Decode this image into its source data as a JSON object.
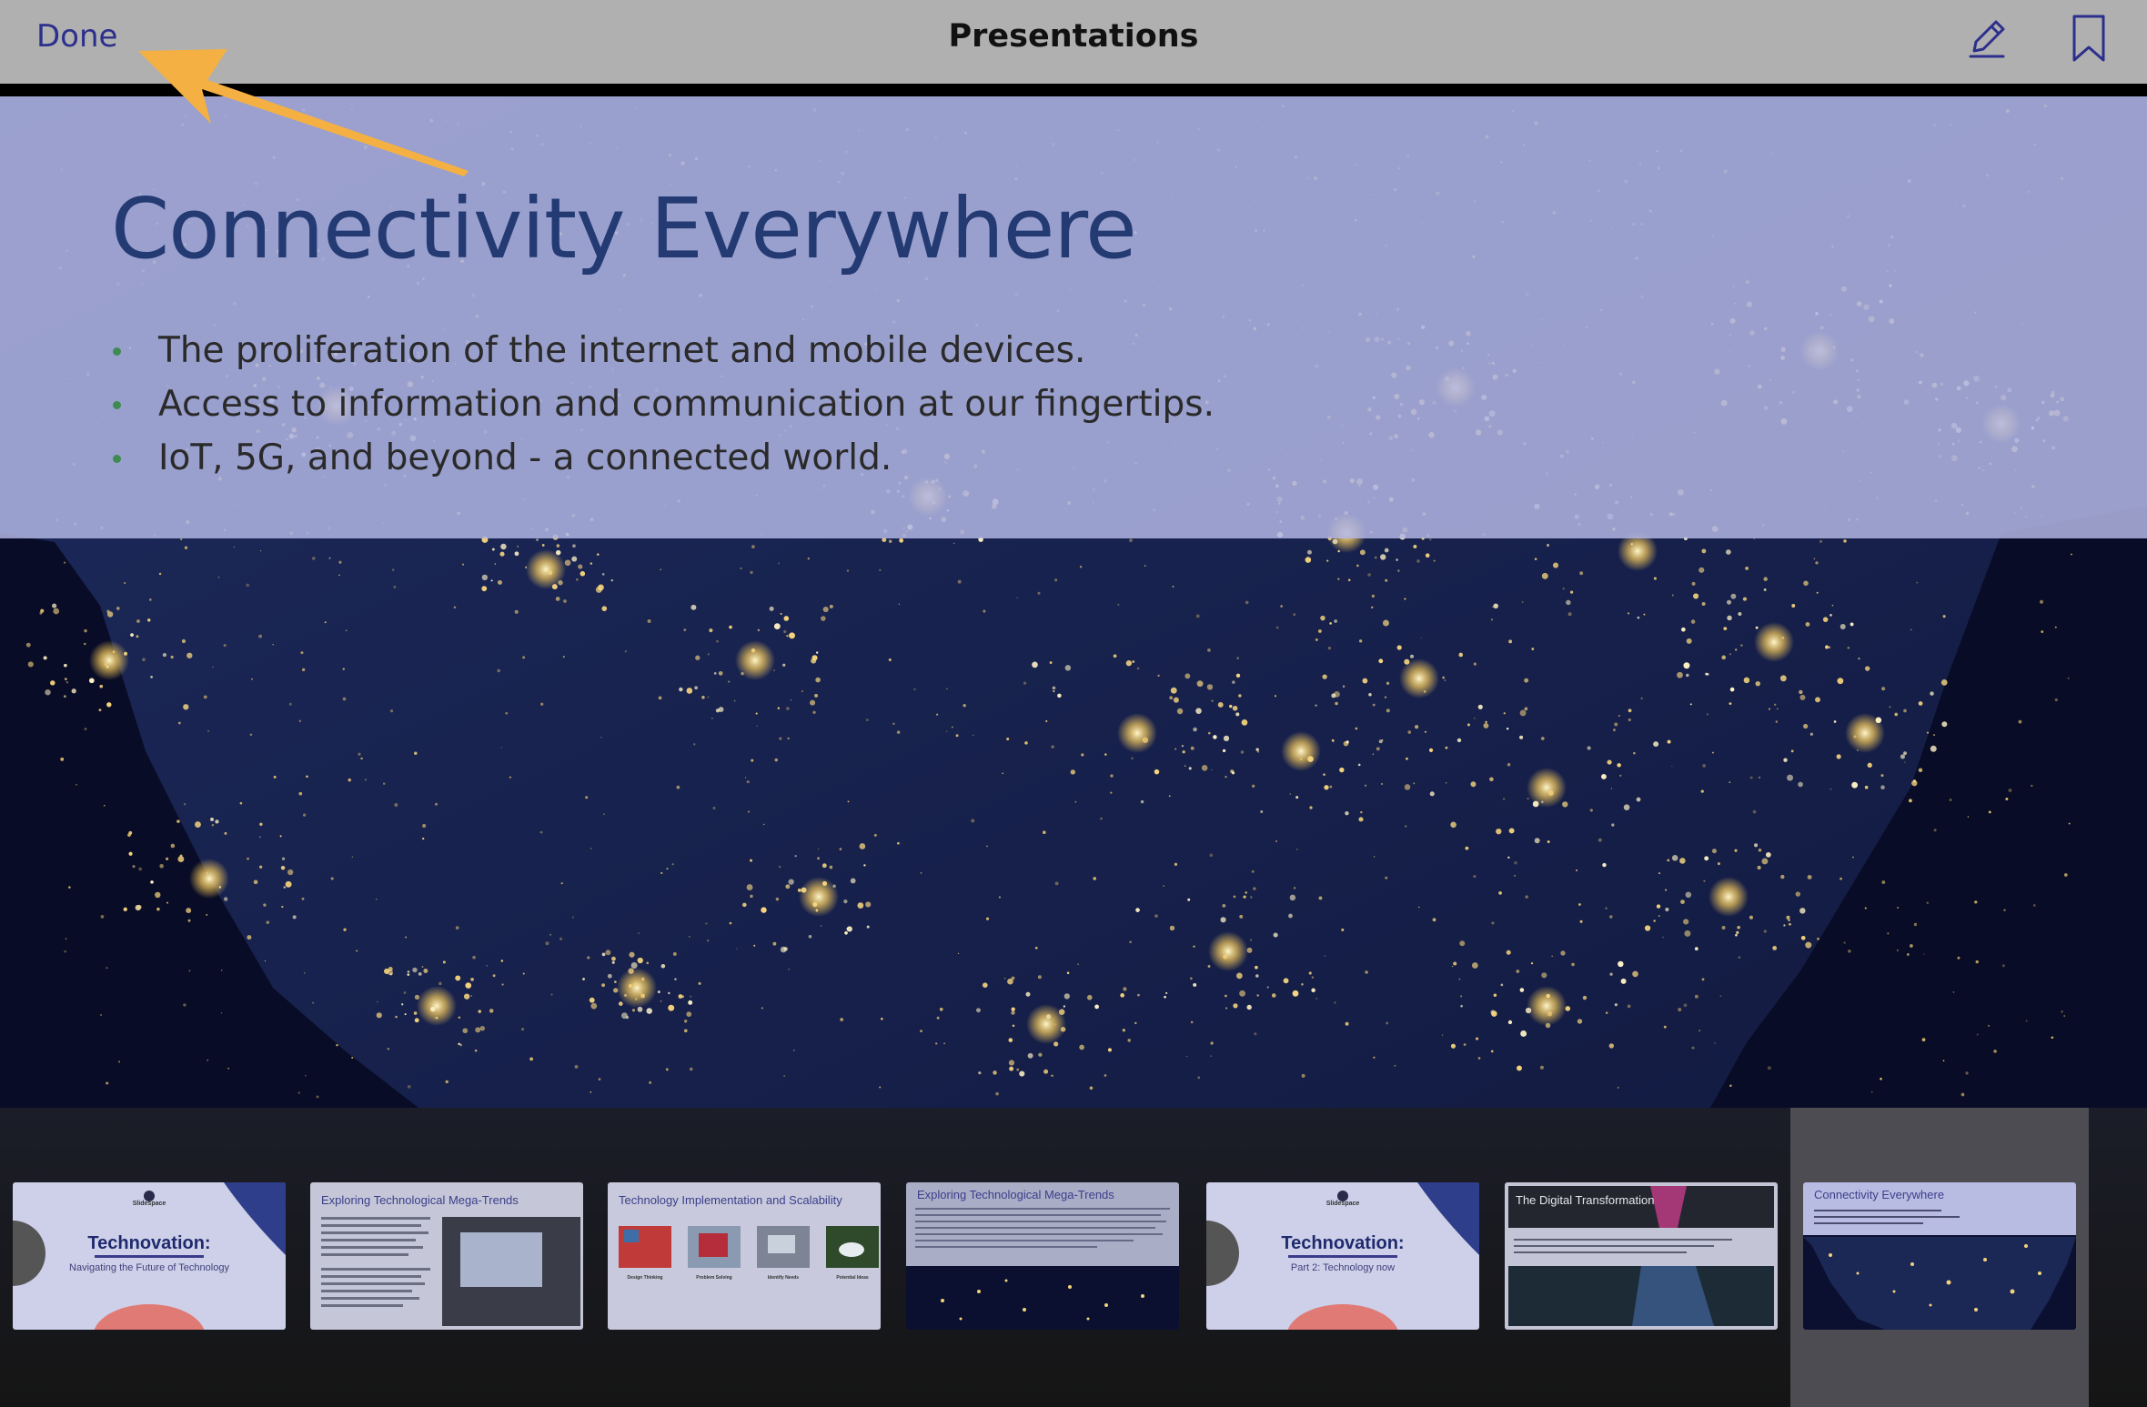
{
  "navbar": {
    "done_label": "Done",
    "title": "Presentations",
    "edit_icon": "pencil-icon",
    "bookmark_icon": "bookmark-icon"
  },
  "slide": {
    "title": "Connectivity Everywhere",
    "bullets": [
      "The proliferation of the internet and mobile devices.",
      "Access to information and communication at our fingertips.",
      "IoT, 5G, and beyond - a connected world."
    ],
    "background": "night-lights-map-image"
  },
  "thumbnails": [
    {
      "title": "Technovation:",
      "subtitle": "Navigating the Future of Technology",
      "logo": "Slidespace"
    },
    {
      "title": "Exploring Technological Mega-Trends"
    },
    {
      "title": "Technology Implementation and Scalability",
      "captions": [
        "Design Thinking",
        "Problem Solving",
        "Identify Needs",
        "Potential Ideas"
      ]
    },
    {
      "title": "Exploring Technological Mega-Trends"
    },
    {
      "title": "Technovation:",
      "subtitle": "Part 2: Technology now",
      "logo": "Slidespace"
    },
    {
      "title": "The Digital Transformation"
    },
    {
      "title": "Connectivity Everywhere",
      "selected": true
    }
  ],
  "colors": {
    "navbar_bg": "#b0b0b0",
    "done_text": "#2c2f8c",
    "slide_title": "#233a73",
    "annotation_arrow": "#f5b043"
  }
}
